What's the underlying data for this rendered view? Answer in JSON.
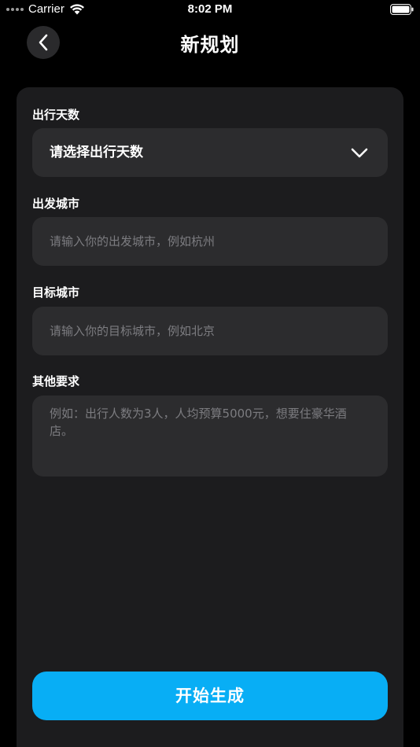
{
  "status_bar": {
    "carrier": "Carrier",
    "time": "8:02 PM"
  },
  "nav": {
    "title": "新规划",
    "back_icon": "chevron-left-icon"
  },
  "form": {
    "days": {
      "label": "出行天数",
      "value": "请选择出行天数",
      "icon": "chevron-down-icon"
    },
    "origin": {
      "label": "出发城市",
      "placeholder": "请输入你的出发城市，例如杭州"
    },
    "destination": {
      "label": "目标城市",
      "placeholder": "请输入你的目标城市，例如北京"
    },
    "requirements": {
      "label": "其他要求",
      "placeholder": "例如：出行人数为3人，人均预算5000元，想要住豪华酒店。"
    },
    "submit_label": "开始生成"
  },
  "colors": {
    "background": "#000000",
    "card": "#1c1c1e",
    "field": "#2c2c2e",
    "placeholder": "#7c7c80",
    "accent": "#08aef5"
  }
}
